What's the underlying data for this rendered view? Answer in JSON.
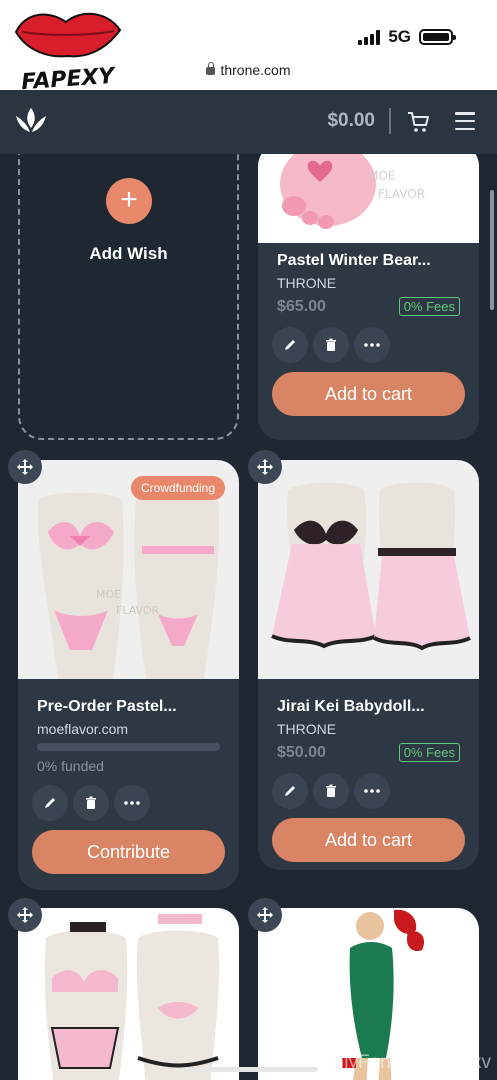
{
  "statusbar": {
    "network": "5G",
    "url": "throne.com"
  },
  "watermark": {
    "logo_text": "FAPEXY",
    "footer": "OnlyFans.com/piexv"
  },
  "header": {
    "balance": "$0.00"
  },
  "add_wish": {
    "label": "Add Wish"
  },
  "items": [
    {
      "title": "Pastel Winter Bear...",
      "store": "THRONE",
      "price": "$65.00",
      "fees": "0% Fees",
      "cta": "Add to cart"
    },
    {
      "title": "Pre-Order Pastel...",
      "store": "moeflavor.com",
      "badge": "Crowdfunding",
      "funded": "0% funded",
      "progress": 0,
      "cta": "Contribute"
    },
    {
      "title": "Jirai Kei Babydoll...",
      "store": "THRONE",
      "price": "$50.00",
      "fees": "0% Fees",
      "cta": "Add to cart"
    }
  ],
  "colors": {
    "accent": "#d98565",
    "fees": "#61c97a",
    "background": "#1f2733",
    "card": "#2e3744"
  }
}
